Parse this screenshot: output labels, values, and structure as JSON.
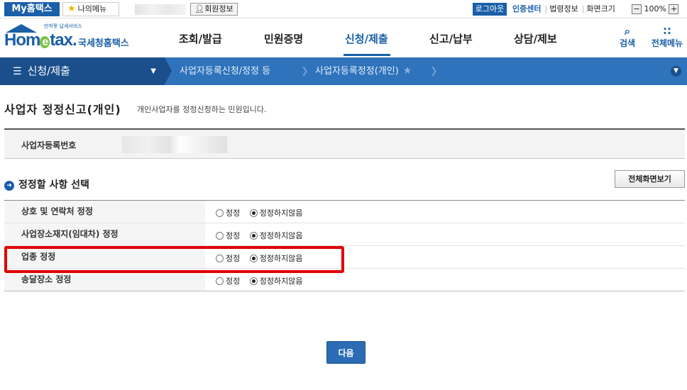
{
  "topbar": {
    "my_hometax": "My홈택스",
    "my_menu": "나의메뉴",
    "member_info": "회원정보",
    "logout": "로그아웃",
    "cert_center": "인증센터",
    "law_info": "법령정보",
    "screen_size": "화면크기",
    "zoom_minus": "−",
    "zoom_value": "100%",
    "zoom_plus": "+"
  },
  "header": {
    "logo_tagline": "만허뫗 납세서비스",
    "logo_word_pre": "Hom",
    "logo_word_e": "e",
    "logo_word_post": "tax.",
    "logo_kname": "국세청홈택스",
    "nav": [
      "조회/발급",
      "민원증명",
      "신청/제출",
      "신고/납부",
      "상담/제보"
    ],
    "active_nav": "신청/제출",
    "search_label": "검색",
    "allmenu_label": "전체메뉴"
  },
  "breadcrumb": {
    "section": "신청/제출",
    "level2": "사업자등록신청/정정 등",
    "level3": "사업자등록정정(개인)"
  },
  "page": {
    "title": "사업자 정정신고(개인)",
    "description": "개인사업자를 정정신청하는 민원입니다.",
    "reg_no_label": "사업자등록번호",
    "section_title": "정정할 사항 선택",
    "full_view_button": "전체화면보기",
    "next_button": "다음"
  },
  "options": {
    "choice_yes": "정정",
    "choice_no": "정정하지않음",
    "rows": [
      {
        "label": "상호 및 연락처 정정",
        "selected": "정정하지않음"
      },
      {
        "label": "사업장소재지(임대차) 정정",
        "selected": "정정하지않음"
      },
      {
        "label": "업종 정정",
        "selected": "정정하지않음"
      },
      {
        "label": "송달장소 정정",
        "selected": "정정하지않음"
      }
    ],
    "highlighted_row": "업종 정정"
  },
  "colors": {
    "brand_blue": "#1a5fa8",
    "crumb_bar": "#2e73bb",
    "crumb_dark": "#1b4f8c",
    "highlight_red": "#e00000"
  }
}
